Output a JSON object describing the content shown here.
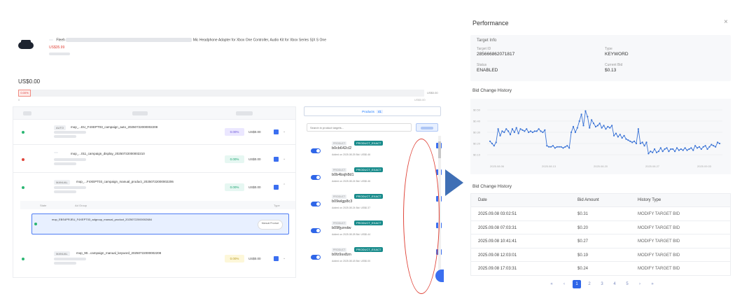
{
  "product": {
    "title_chip": "",
    "title_prefix": "Fleeh",
    "title_suffix": "Mic Headphone Adapter for Xbox One Controller, Audio Kit for Xbox Series S|X S One",
    "price": "US$35.99",
    "price_tag": "",
    "meta": ""
  },
  "budget": {
    "label": "",
    "value": "US$0.00",
    "percent": "0.00%",
    "max": "US$0.00",
    "zero": "0",
    "right": "US$0.00"
  },
  "campaigns": [
    {
      "status": "",
      "status_color": "#2bb673",
      "type": "AUTO",
      "name": "mop_...EU_F4XEPT03_campaign_auto_20250722000002208",
      "acos": "0.00%",
      "acos_color": "#e6f7f2",
      "acos_text": "#1aa36f",
      "bid": "US$0.00"
    },
    {
      "status": "",
      "status_color": "#e0463b",
      "type": "",
      "name": "mop_...011_campaign_display_20250722000002210",
      "acos": "0.00%",
      "acos_color": "#e6f7f2",
      "acos_text": "#1aa36f",
      "bid": "US$0.00"
    },
    {
      "status": "",
      "status_color": "#2bb673",
      "type": "MANUAL",
      "name": "mop_...F4XEPT03_campaign_manual_product_20250722000002206",
      "acos": "0.00%",
      "acos_color": "#e6f7f2",
      "acos_text": "#1aa36f",
      "bid": "US$0.00"
    },
    {
      "status": "",
      "status_color": "#2bb673",
      "type": "MANUAL",
      "name": "mop_90...campaign_manual_keyword_20250722000002208",
      "acos": "0.00%",
      "acos_color": "#fdf7d9",
      "acos_text": "#b89a20",
      "bid": "US$0.00"
    }
  ],
  "ad_group": {
    "col_state": "State",
    "col_name": "Ad Group",
    "col_type": "Type",
    "status": "",
    "name": "mop_EBS4PRJEU_F4XEPT03_adgroup_manual_product_20250722000002684",
    "line2": "",
    "line3": "",
    "button": "Manual Product"
  },
  "targets": {
    "tab_label": "Products",
    "tab_count": "41",
    "search_placeholder": "Search in product targets...",
    "items": [
      {
        "chip": "PRODUCT",
        "match": "PRODUCT_EXACT",
        "asin": "b0cb642cl2",
        "added": "Added on 2025.08.25     Bid: US$0.46"
      },
      {
        "chip": "PRODUCT",
        "match": "PRODUCT_EXACT",
        "asin": "b0b4bsjh8d1",
        "added": "Added on 2025.08.24     Bid: US$0.46"
      },
      {
        "chip": "PRODUCT",
        "match": "PRODUCT_EXACT",
        "asin": "b09wlgp8c3",
        "added": "Added on 2025.08.24     Bid: US$0.37"
      },
      {
        "chip": "PRODUCT",
        "match": "PRODUCT_EXACT",
        "asin": "b09fjyzndw",
        "added": "Added on 2025.08.28     Bid: US$0.44"
      },
      {
        "chip": "PRODUCT",
        "match": "PRODUCT_EXACT",
        "asin": "b0fz9sx8zn",
        "added": "Added on 2025.08.18     Bid: US$0.00"
      }
    ]
  },
  "performance": {
    "title": "Performance",
    "close": "×",
    "target_info": {
      "header": "Target Info",
      "target_id_label": "Target ID",
      "target_id": "285666862071817",
      "type_label": "Type",
      "type": "KEYWORD",
      "status_label": "Status",
      "status": "ENABLED",
      "bid_label": "Current Bid",
      "bid": "$0.13"
    },
    "chart_title": "Bid Change History",
    "history_title": "Bid Change History",
    "table": {
      "col_date": "Date",
      "col_bid": "Bid Amount",
      "col_type": "History Type",
      "rows": [
        {
          "date": "2025.09.08 03:02:51",
          "bid": "$0.31",
          "type": "MODIFY TARGET BID"
        },
        {
          "date": "2025.09.08 07:03:31",
          "bid": "$0.20",
          "type": "MODIFY TARGET BID"
        },
        {
          "date": "2025.09.08 10:41:41",
          "bid": "$0.27",
          "type": "MODIFY TARGET BID"
        },
        {
          "date": "2025.09.08 12:03:01",
          "bid": "$0.19",
          "type": "MODIFY TARGET BID"
        },
        {
          "date": "2025.09.08 17:03:31",
          "bid": "$0.24",
          "type": "MODIFY TARGET BID"
        }
      ]
    },
    "pager": {
      "first": "«",
      "prev": "‹",
      "pages": [
        "1",
        "2",
        "3",
        "4",
        "5"
      ],
      "next": "›",
      "last": "»",
      "active": "1"
    }
  },
  "chart_data": {
    "type": "line",
    "title": "Bid Change History",
    "xlabel": "",
    "ylabel": "",
    "x_ticks": [
      "2025.08.06",
      "2025.08.13",
      "2025.08.20",
      "2025.08.27",
      "2025.09.03"
    ],
    "y_ticks": [
      "$0.10",
      "$0.20",
      "$0.30",
      "$0.40",
      "$0.50"
    ],
    "ylim": [
      0.05,
      0.55
    ],
    "grid": true,
    "series": [
      {
        "color": "#3b74d6",
        "values": [
          0.22,
          0.2,
          0.18,
          0.21,
          0.33,
          0.27,
          0.31,
          0.3,
          0.33,
          0.31,
          0.28,
          0.33,
          0.3,
          0.34,
          0.29,
          0.33,
          0.32,
          0.31,
          0.33,
          0.3,
          0.31,
          0.3,
          0.31,
          0.31,
          0.33,
          0.31,
          0.3,
          0.32,
          0.18,
          0.17,
          0.17,
          0.18,
          0.16,
          0.17,
          0.17,
          0.17,
          0.16,
          0.17,
          0.18,
          0.16,
          0.3,
          0.35,
          0.3,
          0.34,
          0.4,
          0.46,
          0.36,
          0.49,
          0.44,
          0.34,
          0.41,
          0.38,
          0.35,
          0.36,
          0.38,
          0.34,
          0.36,
          0.33,
          0.35,
          0.34,
          0.36,
          0.27,
          0.29,
          0.26,
          0.28,
          0.25,
          0.27,
          0.24,
          0.23,
          0.22,
          0.21,
          0.22,
          0.2,
          0.33,
          0.2,
          0.21,
          0.18,
          0.21,
          0.11,
          0.13,
          0.12,
          0.15,
          0.12,
          0.13,
          0.16,
          0.13,
          0.15,
          0.16,
          0.13,
          0.15,
          0.15,
          0.13,
          0.16,
          0.14,
          0.15,
          0.14,
          0.16,
          0.14,
          0.15,
          0.16,
          0.14,
          0.18,
          0.16,
          0.17,
          0.15,
          0.17,
          0.18,
          0.15,
          0.17,
          0.19,
          0.18,
          0.17,
          0.21,
          0.2
        ]
      }
    ]
  }
}
